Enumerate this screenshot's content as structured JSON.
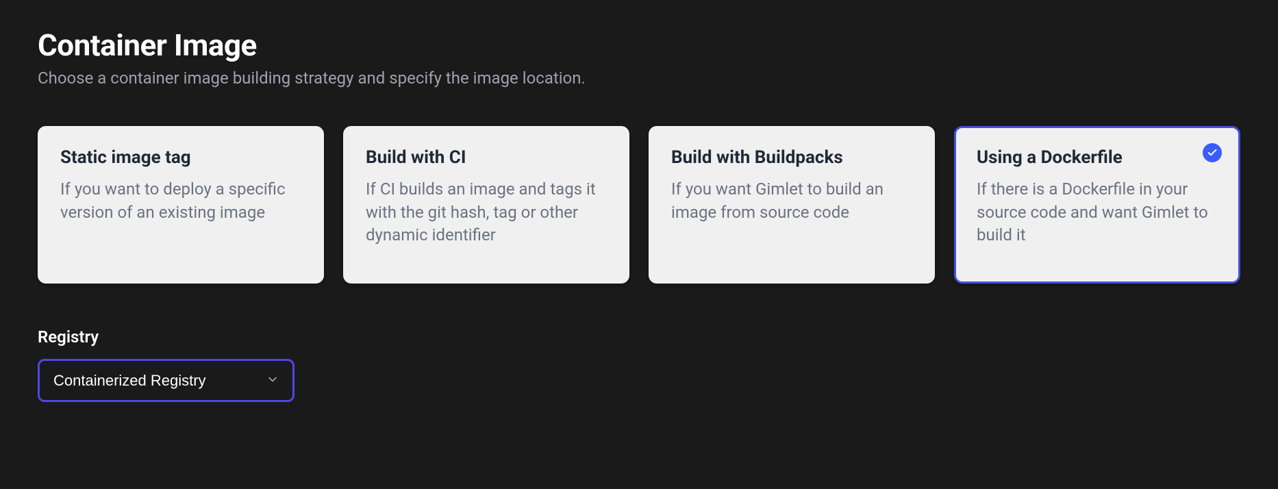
{
  "header": {
    "title": "Container Image",
    "subtitle": "Choose a container image building strategy and specify the image location."
  },
  "strategies": [
    {
      "title": "Static image tag",
      "description": "If you want to deploy a specific version of an existing image",
      "selected": false
    },
    {
      "title": "Build with CI",
      "description": "If CI builds an image and tags it with the git hash, tag or other dynamic identifier",
      "selected": false
    },
    {
      "title": "Build with Buildpacks",
      "description": "If you want Gimlet to build an image from source code",
      "selected": false
    },
    {
      "title": "Using a Dockerfile",
      "description": "If there is a Dockerfile in your source code and want Gimlet to build it",
      "selected": true
    }
  ],
  "registry": {
    "label": "Registry",
    "selected": "Containerized Registry"
  }
}
